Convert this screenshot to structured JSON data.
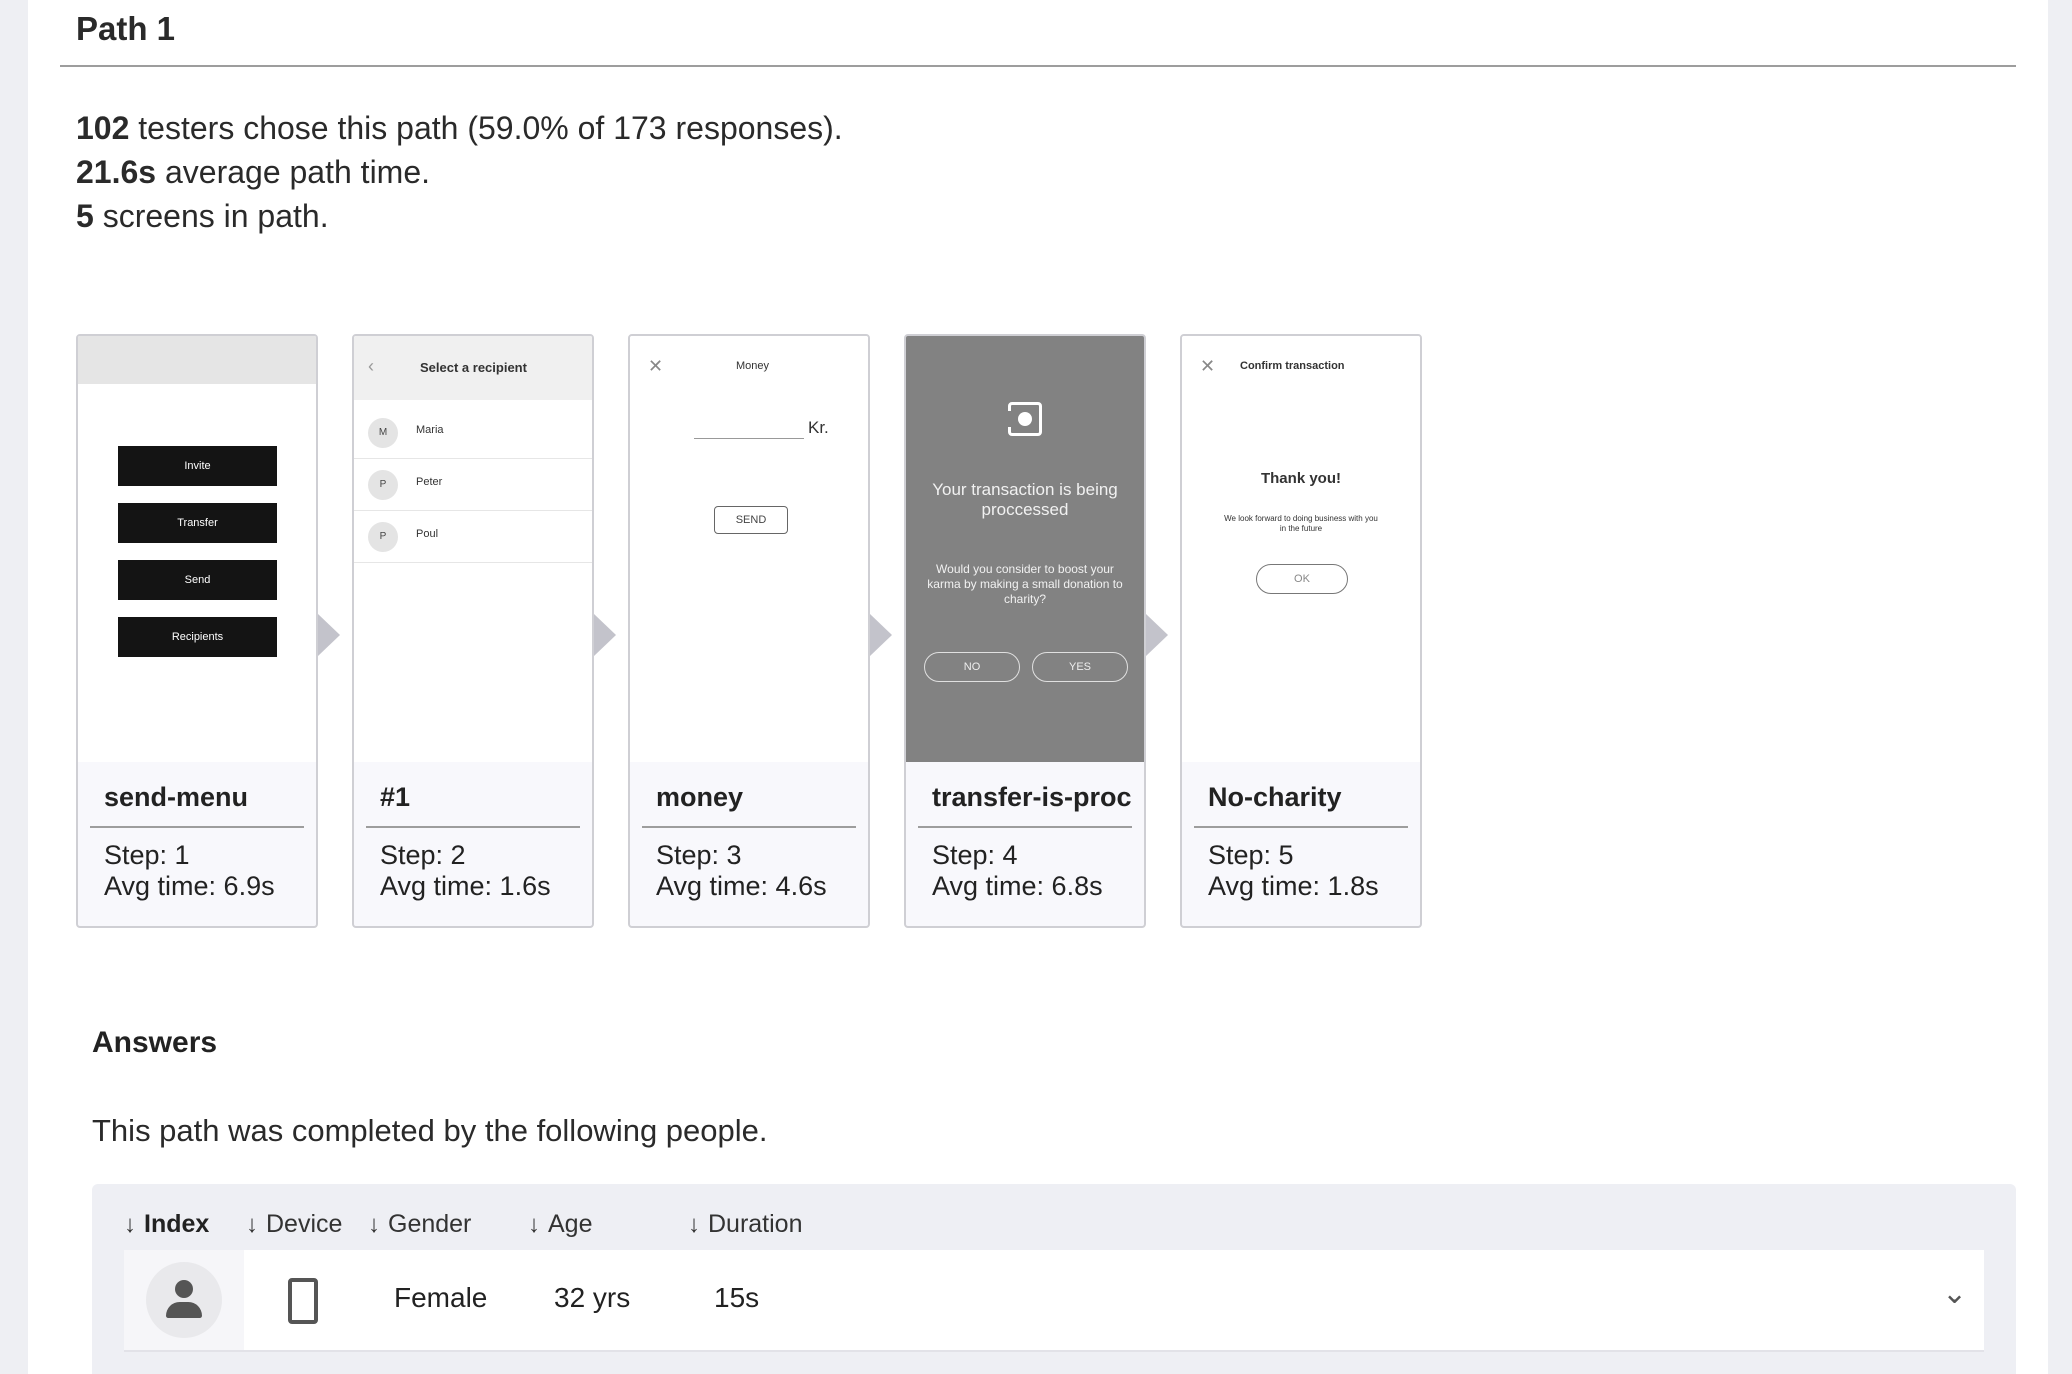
{
  "path": {
    "title": "Path 1",
    "testers_count": "102",
    "testers_text": " testers chose this path (59.0% of 173 responses).",
    "avg_time": "21.6s",
    "avg_time_text": " average path time.",
    "screens_count": "5",
    "screens_text": " screens in path."
  },
  "screens": [
    {
      "name": "send-menu",
      "step": "Step: 1",
      "avg": "Avg time: 6.9s",
      "thumb": {
        "buttons": [
          "Invite",
          "Transfer",
          "Send",
          "Recipients"
        ]
      }
    },
    {
      "name": "#1",
      "step": "Step: 2",
      "avg": "Avg time: 1.6s",
      "thumb": {
        "title": "Select a recipient",
        "recipients": [
          {
            "initial": "M",
            "name": "Maria"
          },
          {
            "initial": "P",
            "name": "Peter"
          },
          {
            "initial": "P",
            "name": "Poul"
          }
        ]
      }
    },
    {
      "name": "money",
      "step": "Step: 3",
      "avg": "Avg time: 4.6s",
      "thumb": {
        "title": "Money",
        "currency": "Kr.",
        "send": "SEND"
      }
    },
    {
      "name": "transfer-is-proc",
      "step": "Step: 4",
      "avg": "Avg time: 6.8s",
      "thumb": {
        "headline": "Your transaction is being proccessed",
        "question": "Would you consider to boost your karma by making a small donation to charity?",
        "no": "NO",
        "yes": "YES"
      }
    },
    {
      "name": "No-charity",
      "step": "Step: 5",
      "avg": "Avg time: 1.8s",
      "thumb": {
        "title": "Confirm transaction",
        "thanks": "Thank you!",
        "message": "We look forward to doing business with you in the future",
        "ok": "OK"
      }
    }
  ],
  "answers": {
    "title": "Answers",
    "description": "This path was completed by the following people.",
    "columns": [
      "Index",
      "Device",
      "Gender",
      "Age",
      "Duration"
    ],
    "rows": [
      {
        "gender": "Female",
        "age": "32 yrs",
        "duration": "15s"
      }
    ]
  },
  "icons": {
    "sort": "arrow-down-icon",
    "avatar": "person-icon",
    "device": "mobile-phone-icon",
    "expand": "chevron-down-icon",
    "close": "close-icon",
    "back": "chevron-left-icon"
  }
}
